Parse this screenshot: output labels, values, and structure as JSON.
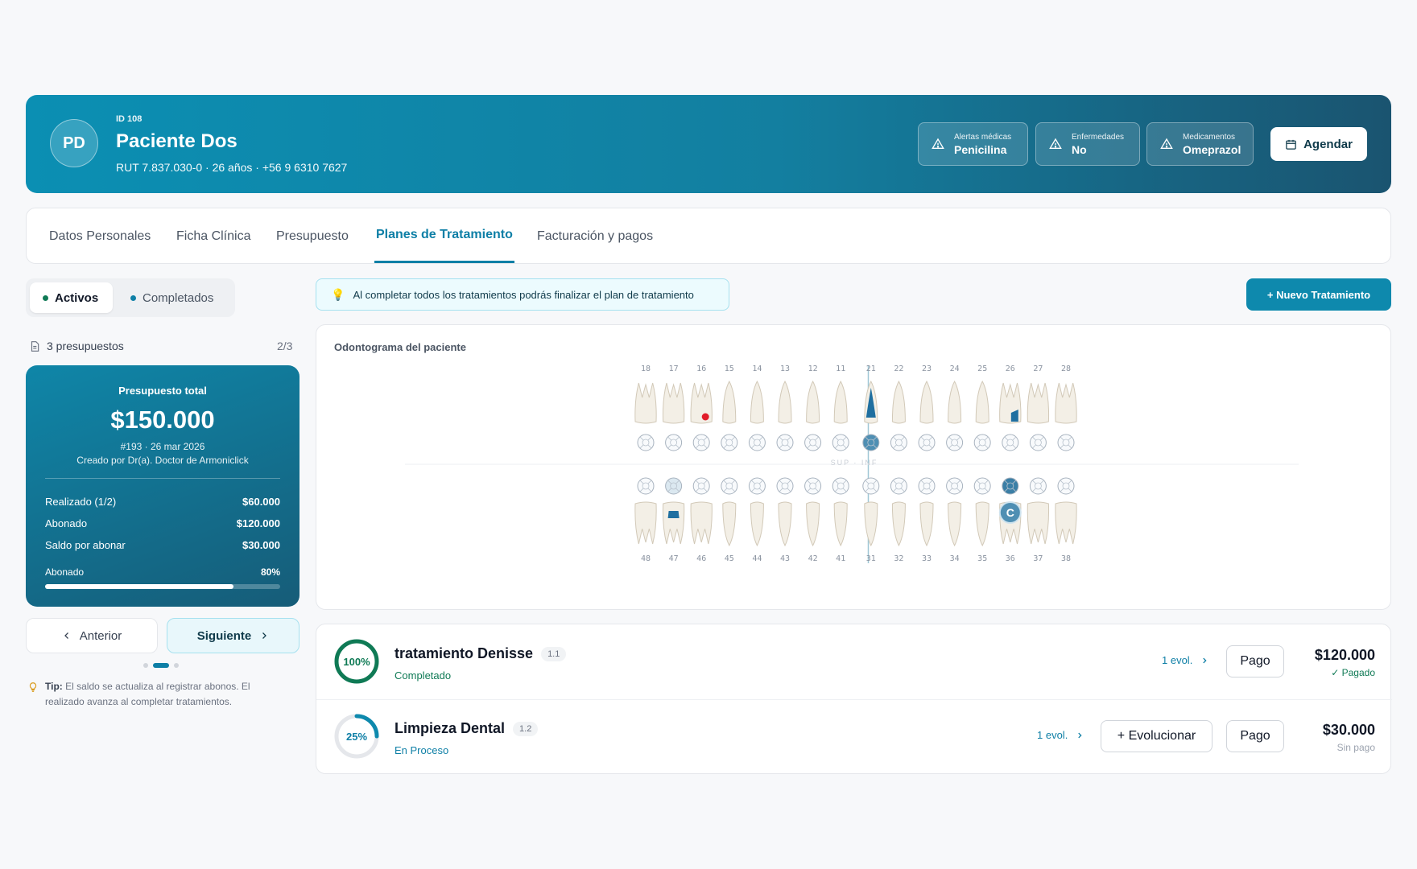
{
  "header": {
    "avatar_initials": "PD",
    "patient_id": "ID 108",
    "patient_name": "Paciente Dos",
    "patient_meta": "RUT 7.837.030-0 · 26 años · +56 9 6310 7627",
    "chips": [
      {
        "label": "Alertas médicas",
        "value": "Penicilina",
        "icon": "alert-triangle-icon"
      },
      {
        "label": "Enfermedades",
        "value": "No",
        "icon": "alert-triangle-icon"
      },
      {
        "label": "Medicamentos",
        "value": "Omeprazol",
        "icon": "alert-triangle-icon"
      }
    ],
    "agendar_label": "Agendar"
  },
  "tabs": [
    {
      "label": "Datos Personales",
      "active": false
    },
    {
      "label": "Ficha Clínica",
      "active": false
    },
    {
      "label": "Presupuesto",
      "active": false
    },
    {
      "label": "Planes de Tratamiento",
      "active": true
    },
    {
      "label": "Facturación y pagos",
      "active": false
    }
  ],
  "filters": {
    "active_label": "Activos",
    "completed_label": "Completados"
  },
  "budgets_info": {
    "count_label": "3 presupuestos",
    "page": "2/3"
  },
  "budget": {
    "title": "Presupuesto total",
    "amount": "$150.000",
    "ref": "#193 · 26 mar 2026",
    "created_by": "Creado por Dr(a). Doctor de Armoniclick",
    "rows": [
      {
        "label": "Realizado (1/2)",
        "value": "$60.000"
      },
      {
        "label": "Abonado",
        "value": "$120.000"
      },
      {
        "label": "Saldo por abonar",
        "value": "$30.000"
      }
    ],
    "progress_label": "Abonado",
    "progress_text": "80%",
    "progress": 0.8
  },
  "nav": {
    "prev_label": "Anterior",
    "next_label": "Siguiente"
  },
  "tip": {
    "label": "Tip:",
    "text": "El saldo se actualiza al registrar abonos. El realizado avanza al completar tratamientos."
  },
  "info_banner": "Al completar todos los tratamientos podrás finalizar el plan de tratamiento",
  "new_treatment_label": "+ Nuevo Tratamiento",
  "odontogram": {
    "title": "Odontograma del paciente",
    "upper": [
      "18",
      "17",
      "16",
      "15",
      "14",
      "13",
      "12",
      "11",
      "21",
      "22",
      "23",
      "24",
      "25",
      "26",
      "27",
      "28"
    ],
    "lower": [
      "48",
      "47",
      "46",
      "45",
      "44",
      "43",
      "42",
      "41",
      "31",
      "32",
      "33",
      "34",
      "35",
      "36",
      "37",
      "38"
    ],
    "divider_label": "SUP · INF",
    "crown_marker": "C"
  },
  "treatments": [
    {
      "percent": "100%",
      "progress": 1.0,
      "name": "tratamiento Denisse",
      "code": "1.1",
      "status": "Completado",
      "evol": "1 evol.",
      "pay_label": "Pago",
      "amount": "$120.000",
      "pay_status": "✓ Pagado",
      "evolve": false
    },
    {
      "percent": "25%",
      "progress": 0.25,
      "name": "Limpieza Dental",
      "code": "1.2",
      "status": "En Proceso",
      "evol": "1 evol.",
      "pay_label": "Pago",
      "evolve_label": "+ Evolucionar",
      "amount": "$30.000",
      "pay_status": "Sin pago",
      "evolve": true
    }
  ],
  "colors": {
    "primary": "#0e7fa6",
    "success": "#0f7a55",
    "header_start": "#0b8fb3",
    "header_end": "#1a5470"
  }
}
